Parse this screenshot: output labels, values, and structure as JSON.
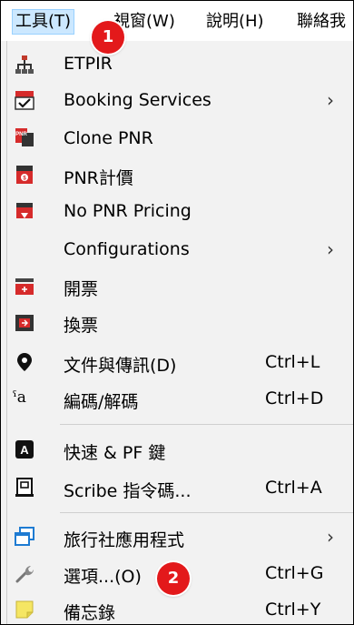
{
  "menubar": {
    "items": [
      {
        "label": "工具(T)"
      },
      {
        "label": "視窗(W)"
      },
      {
        "label": "說明(H)"
      },
      {
        "label": "聯絡我"
      }
    ]
  },
  "menu": {
    "items": [
      {
        "label": "ETPIR",
        "shortcut": "",
        "submenu": false,
        "icon": "network-icon"
      },
      {
        "label": "Booking Services",
        "shortcut": "",
        "submenu": true,
        "icon": "calendar-check-icon"
      },
      {
        "label": "Clone PNR",
        "shortcut": "",
        "submenu": false,
        "icon": "pnr-clone-icon"
      },
      {
        "label": "PNR計價",
        "shortcut": "",
        "submenu": false,
        "icon": "pnr-pricing-icon"
      },
      {
        "label": "No PNR Pricing",
        "shortcut": "",
        "submenu": false,
        "icon": "no-pnr-pricing-icon"
      },
      {
        "label": "Configurations",
        "shortcut": "",
        "submenu": true,
        "icon": ""
      },
      {
        "label": "開票",
        "shortcut": "",
        "submenu": false,
        "icon": "issue-ticket-icon"
      },
      {
        "label": "換票",
        "shortcut": "",
        "submenu": false,
        "icon": "exchange-ticket-icon"
      },
      {
        "label": "文件與傳訊(D)",
        "shortcut": "Ctrl+L",
        "submenu": false,
        "icon": "location-pin-icon"
      },
      {
        "label": "編碼/解碼",
        "shortcut": "Ctrl+D",
        "submenu": false,
        "icon": "encode-decode-icon"
      },
      {
        "label": "快速 & PF 鍵",
        "shortcut": "",
        "submenu": false,
        "icon": "key-a-icon"
      },
      {
        "label": "Scribe 指令碼...",
        "shortcut": "Ctrl+A",
        "submenu": false,
        "icon": "script-icon"
      },
      {
        "label": "旅行社應用程式",
        "shortcut": "",
        "submenu": true,
        "icon": "windows-stack-icon"
      },
      {
        "label": "選項...(O)",
        "shortcut": "Ctrl+G",
        "submenu": false,
        "icon": "wrench-icon"
      },
      {
        "label": "備忘錄",
        "shortcut": "Ctrl+Y",
        "submenu": false,
        "icon": "sticky-note-icon"
      }
    ]
  },
  "annotations": [
    "1",
    "2"
  ],
  "colors": {
    "highlight": "#cce8ff",
    "badge": "#e3191b",
    "menu_bg": "#f2f2f2"
  }
}
